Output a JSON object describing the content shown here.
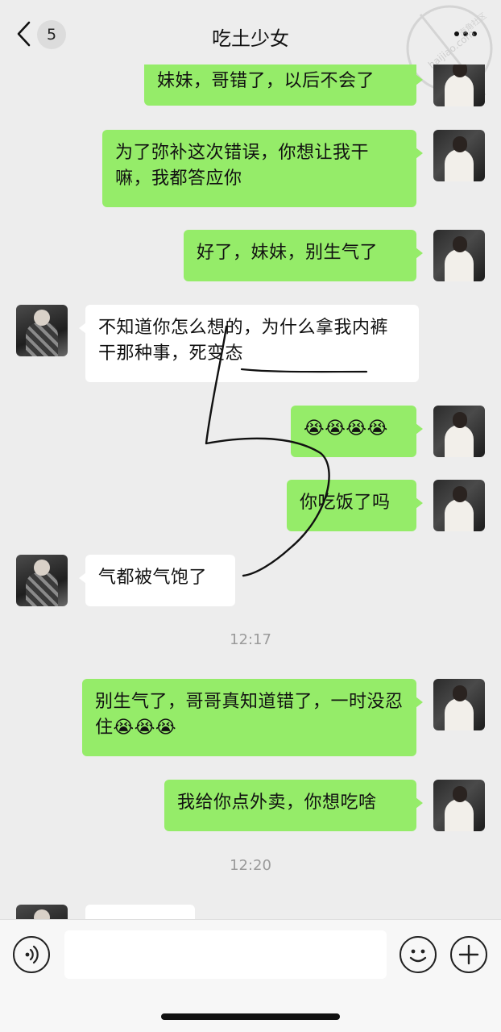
{
  "header": {
    "title": "吃土少女",
    "unread_count": "5"
  },
  "watermark": {
    "text": "haijiao.com",
    "text_cn": "海角社区"
  },
  "messages": [
    {
      "from": "me",
      "text": "妹妹，哥错了，以后不会了"
    },
    {
      "from": "me",
      "text": "为了弥补这次错误，你想让我干嘛，我都答应你"
    },
    {
      "from": "me",
      "text": "好了，妹妹，别生气了"
    },
    {
      "from": "them",
      "text": "不知道你怎么想的，为什么拿我内裤干那种事，死变态"
    },
    {
      "from": "me",
      "text": "😭😭😭😭"
    },
    {
      "from": "me",
      "text": "你吃饭了吗"
    },
    {
      "from": "them",
      "text": "气都被气饱了"
    },
    {
      "from": "me",
      "text": "别生气了，哥哥真知道错了，一时没忍住😭😭😭"
    },
    {
      "from": "me",
      "text": "我给你点外卖，你想吃啥"
    }
  ],
  "timestamps": [
    "12:17",
    "12:20"
  ],
  "colors": {
    "my_bubble": "#95ec69",
    "their_bubble": "#ffffff",
    "background": "#ededed",
    "scribble": "#111111"
  },
  "icons": {
    "back": "chevron-left-icon",
    "more": "more-dots-icon",
    "voice": "voice-icon",
    "emoji": "emoji-icon",
    "plus": "plus-icon"
  }
}
